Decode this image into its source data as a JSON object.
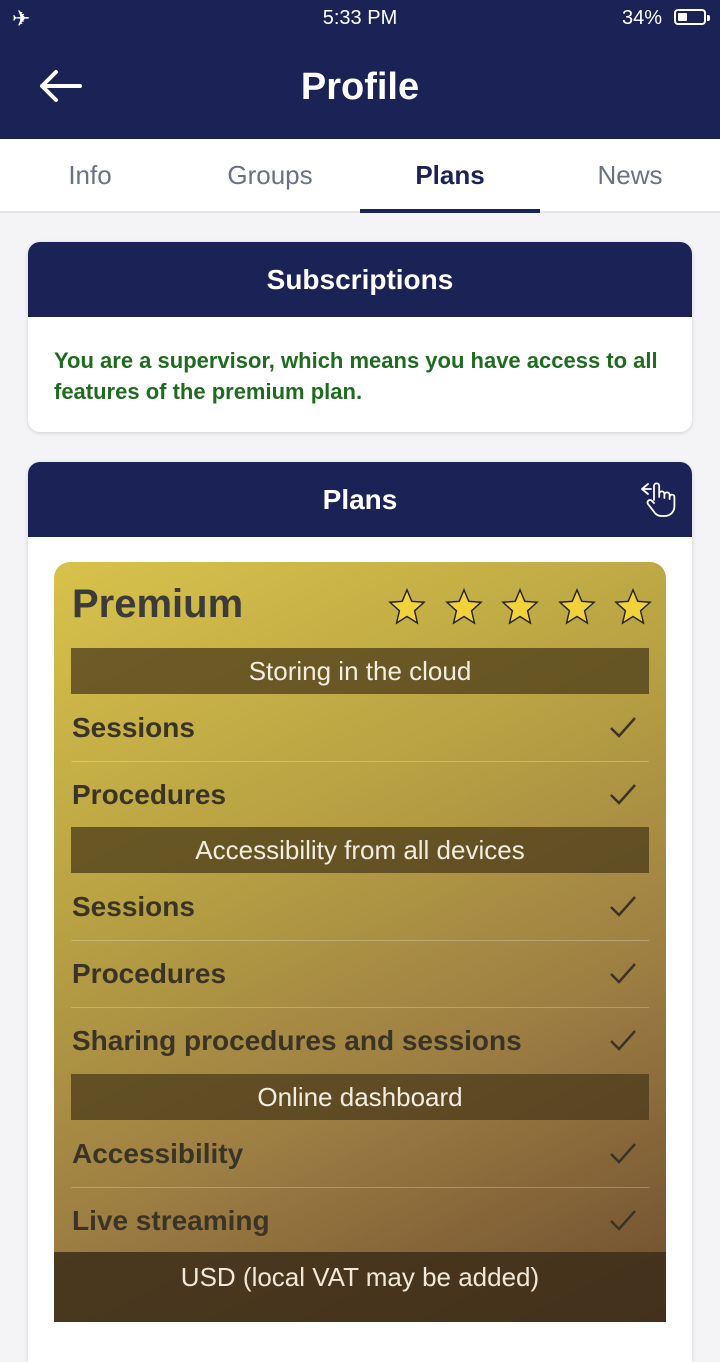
{
  "status_bar": {
    "time": "5:33 PM",
    "battery": "34%"
  },
  "header": {
    "title": "Profile"
  },
  "tabs": [
    {
      "label": "Info"
    },
    {
      "label": "Groups"
    },
    {
      "label": "Plans"
    },
    {
      "label": "News"
    }
  ],
  "subscriptions": {
    "title": "Subscriptions",
    "message": "You are a supervisor, which means you have access to all features of the premium plan."
  },
  "plans": {
    "title": "Plans",
    "plan_name": "Premium",
    "rating": 5,
    "sections": [
      {
        "title": "Storing in the cloud",
        "features": [
          "Sessions",
          "Procedures"
        ]
      },
      {
        "title": "Accessibility from all devices",
        "features": [
          "Sessions",
          "Procedures",
          "Sharing procedures and sessions"
        ]
      },
      {
        "title": "Online dashboard",
        "features": [
          "Accessibility",
          "Live streaming"
        ]
      }
    ],
    "price_partial": "USD (local VAT may be added)"
  },
  "colors": {
    "navy": "#1b2255",
    "success_text": "#1f6b1f",
    "star": "#f2d23a"
  },
  "icons": {
    "back": "arrow-left-icon",
    "swipe": "swipe-hand-icon",
    "star": "star-icon",
    "check": "checkmark-icon",
    "airplane": "airplane-icon",
    "battery": "battery-icon"
  }
}
